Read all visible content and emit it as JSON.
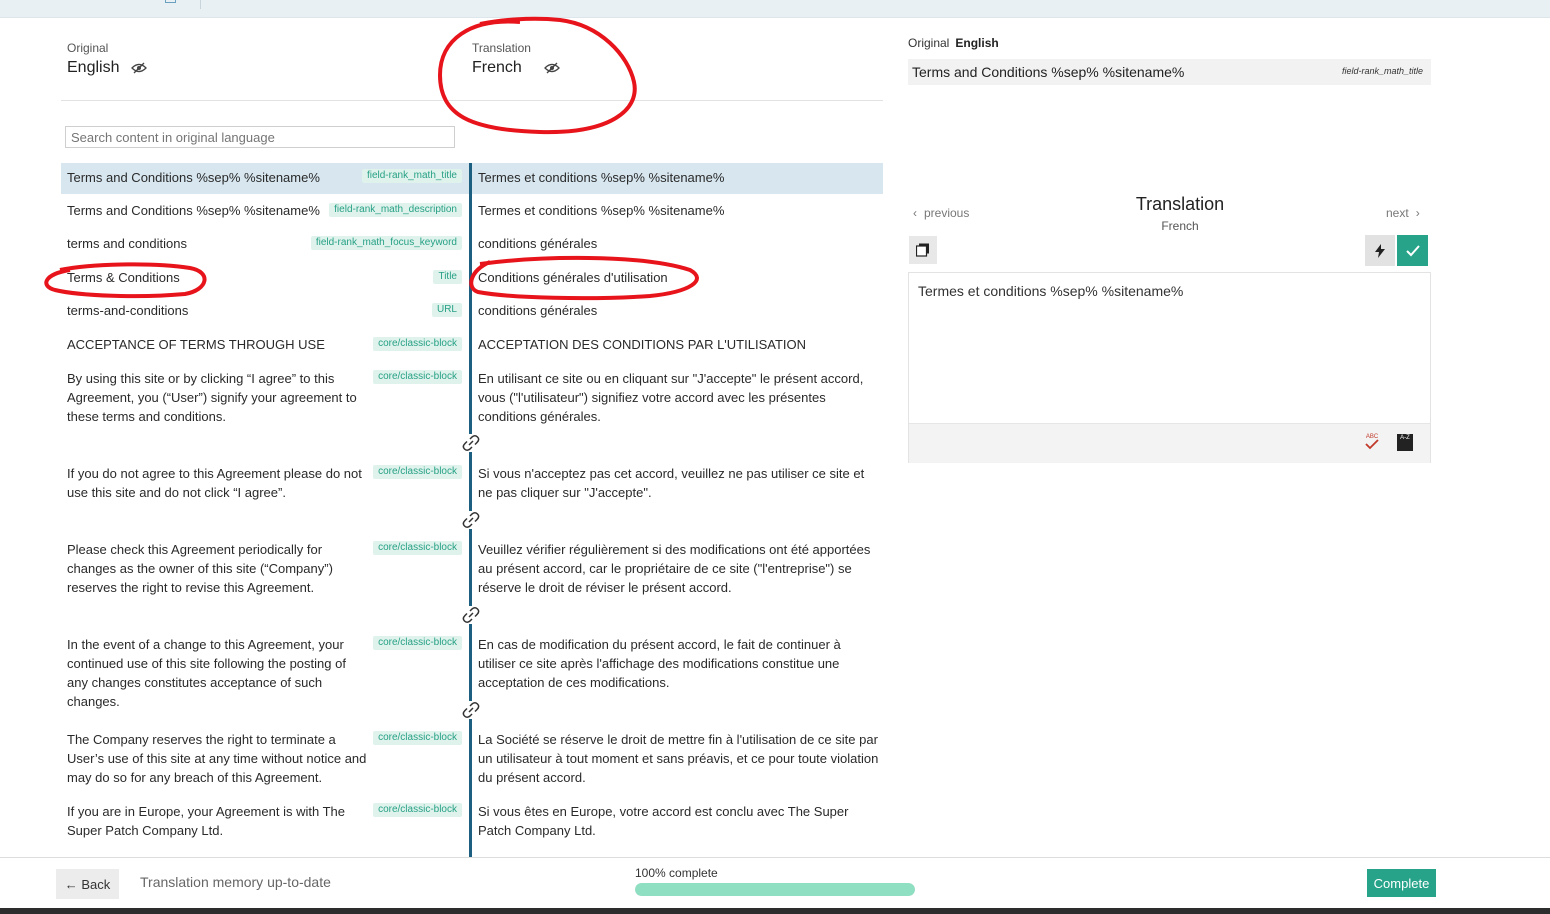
{
  "header": {
    "original_caption": "Original",
    "original_language": "English",
    "translation_caption": "Translation",
    "translation_language": "French"
  },
  "search": {
    "placeholder": "Search content in original language"
  },
  "rows": [
    {
      "original": "Terms and Conditions %sep% %sitename%",
      "tag": "field-rank_math_title",
      "translation": "Termes et conditions %sep% %sitename%"
    },
    {
      "original": "Terms and Conditions %sep% %sitename%",
      "tag": "field-rank_math_description",
      "translation": "Termes et conditions %sep% %sitename%"
    },
    {
      "original": "terms and conditions",
      "tag": "field-rank_math_focus_keyword",
      "translation": "conditions générales"
    },
    {
      "original": "Terms & Conditions",
      "tag": "Title",
      "translation": "Conditions générales d'utilisation"
    },
    {
      "original": "terms-and-conditions",
      "tag": "URL",
      "translation": "conditions générales"
    },
    {
      "original": "ACCEPTANCE OF TERMS THROUGH USE",
      "tag": "core/classic-block",
      "translation": "ACCEPTATION DES CONDITIONS PAR L'UTILISATION"
    },
    {
      "original": "By using this site or by clicking “I agree” to this Agreement, you (“User”) signify your agreement to these terms and conditions.",
      "tag": "core/classic-block",
      "translation": "En utilisant ce site ou en cliquant sur \"J'accepte\" le présent accord, vous (\"l'utilisateur\") signifiez votre accord avec les présentes conditions générales."
    },
    {
      "original": "If you do not agree to this Agreement please do not use this site and do not click “I agree”.",
      "tag": "core/classic-block",
      "translation": "Si vous n'acceptez pas cet accord, veuillez ne pas utiliser ce site et ne pas cliquer sur \"J'accepte\"."
    },
    {
      "original": "Please check this Agreement periodically for changes as the owner of this site (“Company”) reserves the right to revise this Agreement.",
      "tag": "core/classic-block",
      "translation": "Veuillez vérifier régulièrement si des modifications ont été apportées au présent accord, car le propriétaire de ce site (\"l'entreprise\") se réserve le droit de réviser le présent accord."
    },
    {
      "original": "In the event of a change to this Agreement, your continued use of this site following the posting of any changes constitutes acceptance of such changes.",
      "tag": "core/classic-block",
      "translation": "En cas de modification du présent accord, le fait de continuer à utiliser ce site après l'affichage des modifications constitue une acceptation de ces modifications."
    },
    {
      "original": "The Company reserves the right to terminate a User’s use of this site at any time without notice and may do so for any breach of this Agreement.",
      "tag": "core/classic-block",
      "translation": "La Société se réserve le droit de mettre fin à l'utilisation de ce site par un utilisateur à tout moment et sans préavis, et ce pour toute violation du présent accord."
    },
    {
      "original": "If you are in Europe, your Agreement is with The Super Patch Company Ltd.",
      "tag": "core/classic-block",
      "translation": "Si vous êtes en Europe, votre accord est conclu avec The Super Patch Company Ltd."
    }
  ],
  "panel": {
    "original_caption": "Original",
    "original_language": "English",
    "source_text": "Terms and Conditions %sep% %sitename%",
    "source_tag": "field-rank_math_title",
    "title": "Translation",
    "language": "French",
    "prev_label": "previous",
    "next_label": "next",
    "editor_text": "Termes et conditions %sep% %sitename%",
    "spell_icon_text": "ABC",
    "az_icon_text": "A-Z"
  },
  "footer": {
    "back_label": "← Back",
    "status": "Translation memory up-to-date",
    "progress_label": "100% complete",
    "progress": 1.0,
    "complete_label": "Complete"
  },
  "colors": {
    "accent": "#26a389",
    "active_row": "#d7e6ef",
    "divider": "#1d5f80",
    "annotation": "#e8141b",
    "progress_fill": "#8fe0c2"
  }
}
